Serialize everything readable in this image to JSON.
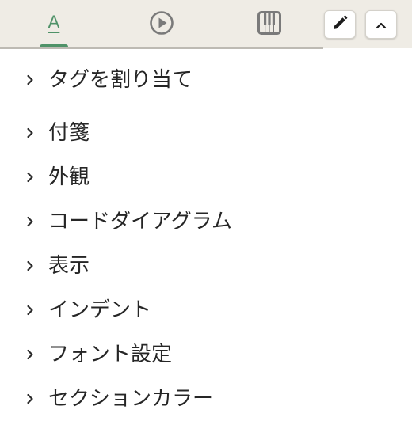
{
  "toolbar": {
    "tabs": [
      {
        "icon": "text-format-icon",
        "glyph": "A",
        "active": true
      },
      {
        "icon": "play-circle-icon",
        "active": false
      },
      {
        "icon": "piano-keys-icon",
        "active": false
      }
    ],
    "buttons": [
      {
        "icon": "pencil-icon"
      },
      {
        "icon": "chevron-up-icon"
      }
    ],
    "accent_color": "#4f9268"
  },
  "sections": [
    {
      "label": "タグを割り当て"
    },
    {
      "label": "付箋"
    },
    {
      "label": "外観"
    },
    {
      "label": "コードダイアグラム"
    },
    {
      "label": "表示"
    },
    {
      "label": "インデント"
    },
    {
      "label": "フォント設定"
    },
    {
      "label": "セクションカラー"
    }
  ]
}
